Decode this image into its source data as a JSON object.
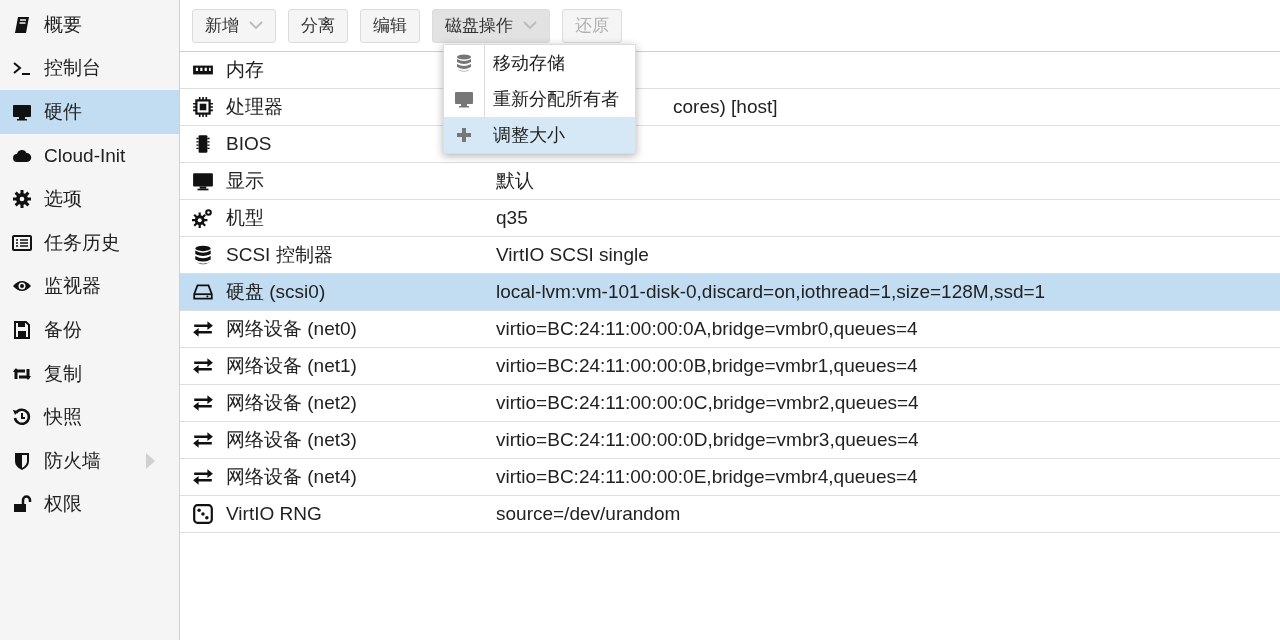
{
  "sidebar": {
    "items": [
      {
        "label": "概要",
        "selected": false,
        "expandable": false
      },
      {
        "label": "控制台",
        "selected": false,
        "expandable": false
      },
      {
        "label": "硬件",
        "selected": true,
        "expandable": false
      },
      {
        "label": "Cloud-Init",
        "selected": false,
        "expandable": false
      },
      {
        "label": "选项",
        "selected": false,
        "expandable": false
      },
      {
        "label": "任务历史",
        "selected": false,
        "expandable": false
      },
      {
        "label": "监视器",
        "selected": false,
        "expandable": false
      },
      {
        "label": "备份",
        "selected": false,
        "expandable": false
      },
      {
        "label": "复制",
        "selected": false,
        "expandable": false
      },
      {
        "label": "快照",
        "selected": false,
        "expandable": false
      },
      {
        "label": "防火墙",
        "selected": false,
        "expandable": true
      },
      {
        "label": "权限",
        "selected": false,
        "expandable": false
      }
    ]
  },
  "toolbar": {
    "buttons": [
      {
        "label": "新增",
        "dropdown": true,
        "disabled": false,
        "pressed": false
      },
      {
        "label": "分离",
        "dropdown": false,
        "disabled": false,
        "pressed": false
      },
      {
        "label": "编辑",
        "dropdown": false,
        "disabled": false,
        "pressed": false
      },
      {
        "label": "磁盘操作",
        "dropdown": true,
        "disabled": false,
        "pressed": true
      },
      {
        "label": "还原",
        "dropdown": false,
        "disabled": true,
        "pressed": false
      }
    ]
  },
  "menu": {
    "items": [
      {
        "label": "移动存储",
        "selected": false
      },
      {
        "label": "重新分配所有者",
        "selected": false
      },
      {
        "label": "调整大小",
        "selected": true
      }
    ]
  },
  "table": {
    "rows": [
      {
        "name": "内存",
        "selected": false
      },
      {
        "name": "处理器",
        "value": "cores) [host]",
        "selected": false
      },
      {
        "name": "BIOS",
        "selected": false
      },
      {
        "name": "显示",
        "value": "默认",
        "selected": false
      },
      {
        "name": "机型",
        "value": "q35",
        "selected": false
      },
      {
        "name": "SCSI 控制器",
        "value": "VirtIO SCSI single",
        "selected": false
      },
      {
        "name": "硬盘 (scsi0)",
        "value": "local-lvm:vm-101-disk-0,discard=on,iothread=1,size=128M,ssd=1",
        "selected": true
      },
      {
        "name": "网络设备 (net0)",
        "value": "virtio=BC:24:11:00:00:0A,bridge=vmbr0,queues=4",
        "selected": false
      },
      {
        "name": "网络设备 (net1)",
        "value": "virtio=BC:24:11:00:00:0B,bridge=vmbr1,queues=4",
        "selected": false
      },
      {
        "name": "网络设备 (net2)",
        "value": "virtio=BC:24:11:00:00:0C,bridge=vmbr2,queues=4",
        "selected": false
      },
      {
        "name": "网络设备 (net3)",
        "value": "virtio=BC:24:11:00:00:0D,bridge=vmbr3,queues=4",
        "selected": false
      },
      {
        "name": "网络设备 (net4)",
        "value": "virtio=BC:24:11:00:00:0E,bridge=vmbr4,queues=4",
        "selected": false
      },
      {
        "name": "VirtIO RNG",
        "value": "source=/dev/urandom",
        "selected": false
      }
    ]
  }
}
